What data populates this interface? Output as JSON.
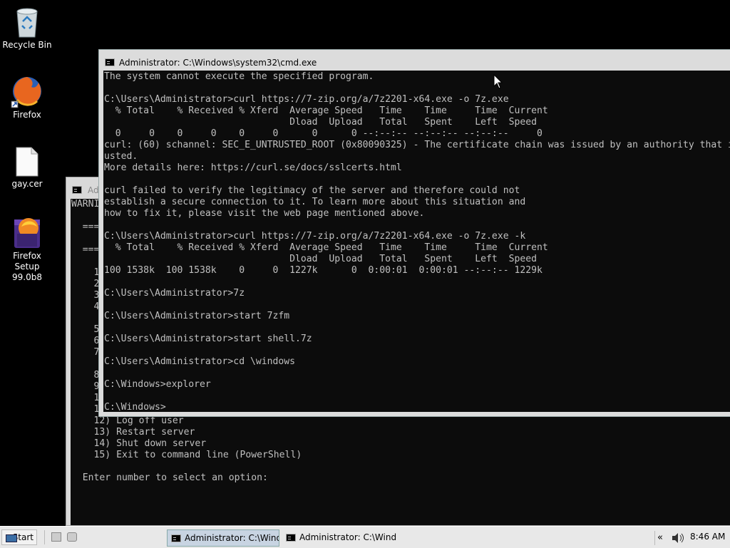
{
  "desktop": {
    "icons": [
      {
        "label": "Recycle Bin"
      },
      {
        "label": "Firefox"
      },
      {
        "label": "gay.cer"
      },
      {
        "label": "Firefox Setup 99.0b8"
      }
    ]
  },
  "back_window": {
    "title": "Ad",
    "console_lines": "WARNI\n\n  ===\n\n  ===\n\n    1\n    2\n    3\n    4\n\n    5\n    6\n    7\n\n    8\n    9\n    1\n    11\n    12) Log off user\n    13) Restart server\n    14) Shut down server\n    15) Exit to command line (PowerShell)\n\n  Enter number to select an option:"
  },
  "front_window": {
    "title": "Administrator: C:\\Windows\\system32\\cmd.exe",
    "console_lines": "The system cannot execute the specified program.\n\nC:\\Users\\Administrator>curl https://7-zip.org/a/7z2201-x64.exe -o 7z.exe\n  % Total    % Received % Xferd  Average Speed   Time    Time     Time  Current\n                                 Dload  Upload   Total   Spent    Left  Speed\n  0     0    0     0    0     0      0      0 --:--:-- --:--:-- --:--:--     0\ncurl: (60) schannel: SEC_E_UNTRUSTED_ROOT (0x80090325) - The certificate chain was issued by an authority that is not tr\nusted.\nMore details here: https://curl.se/docs/sslcerts.html\n\ncurl failed to verify the legitimacy of the server and therefore could not\nestablish a secure connection to it. To learn more about this situation and\nhow to fix it, please visit the web page mentioned above.\n\nC:\\Users\\Administrator>curl https://7-zip.org/a/7z2201-x64.exe -o 7z.exe -k\n  % Total    % Received % Xferd  Average Speed   Time    Time     Time  Current\n                                 Dload  Upload   Total   Spent    Left  Speed\n100 1538k  100 1538k    0     0  1227k      0  0:00:01  0:00:01 --:--:-- 1229k\n\nC:\\Users\\Administrator>7z\n\nC:\\Users\\Administrator>start 7zfm\n\nC:\\Users\\Administrator>start shell.7z\n\nC:\\Users\\Administrator>cd \\windows\n\nC:\\Windows>explorer\n\nC:\\Windows>"
  },
  "taskbar": {
    "start_label": "Start",
    "tasks": [
      {
        "label": "Administrator: C:\\Wind...",
        "active": true
      },
      {
        "label": "Administrator: C:\\Wind...",
        "active": false
      }
    ],
    "tray": {
      "chevron": "«",
      "time": "8:46 AM"
    }
  },
  "colors": {
    "console_bg": "#0c0c0c",
    "console_fg": "#c0c0c0",
    "desktop_bg": "#000000",
    "taskbar_bg": "#e8e8e8"
  }
}
